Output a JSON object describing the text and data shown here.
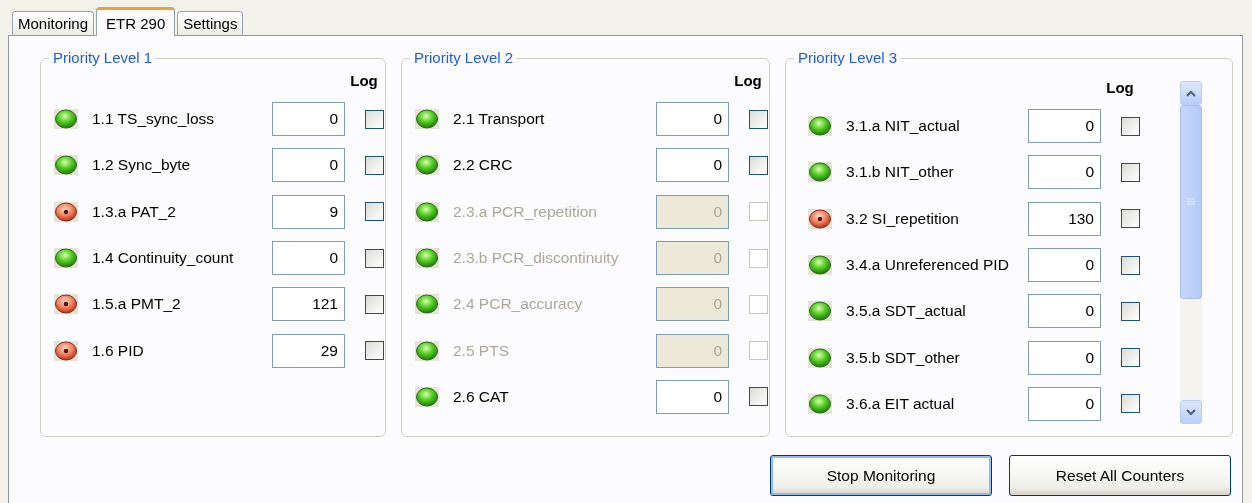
{
  "tabs": [
    {
      "label": "Monitoring",
      "selected": false
    },
    {
      "label": "ETR 290",
      "selected": true
    },
    {
      "label": "Settings",
      "selected": false
    }
  ],
  "groups": [
    {
      "title": "Priority Level 1",
      "log_header": "Log",
      "scrollable": false,
      "rows": [
        {
          "label": "1.1 TS_sync_loss",
          "error": false,
          "count": "0",
          "log": false,
          "disabled": false
        },
        {
          "label": "1.2 Sync_byte",
          "error": false,
          "count": "0",
          "log": false,
          "disabled": false
        },
        {
          "label": "1.3.a PAT_2",
          "error": true,
          "count": "9",
          "log": false,
          "disabled": false
        },
        {
          "label": "1.4 Continuity_count",
          "error": false,
          "count": "0",
          "log": false,
          "disabled": false
        },
        {
          "label": "1.5.a PMT_2",
          "error": true,
          "count": "121",
          "log": false,
          "disabled": false
        },
        {
          "label": "1.6 PID",
          "error": true,
          "count": "29",
          "log": false,
          "disabled": false
        }
      ]
    },
    {
      "title": "Priority Level 2",
      "log_header": "Log",
      "scrollable": false,
      "rows": [
        {
          "label": "2.1 Transport",
          "error": false,
          "count": "0",
          "log": false,
          "disabled": false
        },
        {
          "label": "2.2 CRC",
          "error": false,
          "count": "0",
          "log": false,
          "disabled": false
        },
        {
          "label": "2.3.a PCR_repetition",
          "error": false,
          "count": "0",
          "log": false,
          "disabled": true
        },
        {
          "label": "2.3.b PCR_discontinuity",
          "error": false,
          "count": "0",
          "log": false,
          "disabled": true
        },
        {
          "label": "2.4 PCR_accuracy",
          "error": false,
          "count": "0",
          "log": false,
          "disabled": true
        },
        {
          "label": "2.5 PTS",
          "error": false,
          "count": "0",
          "log": false,
          "disabled": true
        },
        {
          "label": "2.6 CAT",
          "error": false,
          "count": "0",
          "log": false,
          "disabled": false
        }
      ]
    },
    {
      "title": "Priority Level 3",
      "log_header": "Log",
      "scrollable": true,
      "rows": [
        {
          "label": "3.1.a NIT_actual",
          "error": false,
          "count": "0",
          "log": false,
          "disabled": false
        },
        {
          "label": "3.1.b NIT_other",
          "error": false,
          "count": "0",
          "log": false,
          "disabled": false
        },
        {
          "label": "3.2 SI_repetition",
          "error": true,
          "count": "130",
          "log": false,
          "disabled": false
        },
        {
          "label": "3.4.a Unreferenced PID",
          "error": false,
          "count": "0",
          "log": false,
          "disabled": false
        },
        {
          "label": "3.5.a SDT_actual",
          "error": false,
          "count": "0",
          "log": false,
          "disabled": false
        },
        {
          "label": "3.5.b SDT_other",
          "error": false,
          "count": "0",
          "log": false,
          "disabled": false
        },
        {
          "label": "3.6.a EIT actual",
          "error": false,
          "count": "0",
          "log": false,
          "disabled": false
        }
      ]
    }
  ],
  "buttons": [
    {
      "label": "Stop Monitoring",
      "focused": true
    },
    {
      "label": "Reset All Counters",
      "focused": false
    }
  ]
}
